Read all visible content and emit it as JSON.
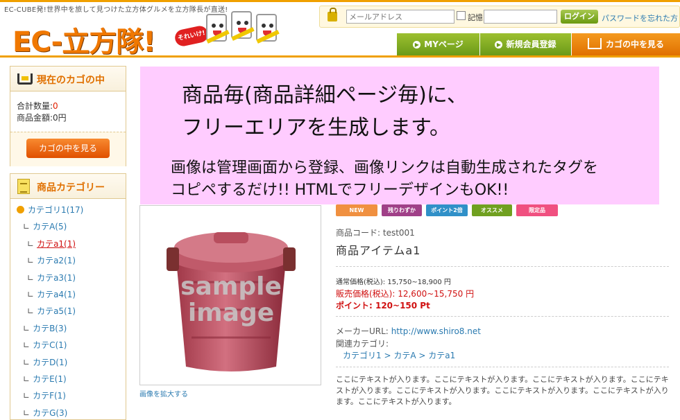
{
  "header": {
    "tagline": "EC-CUBE発!世界中を旅して見つけた立方体グルメを立方隊長が直送!",
    "logo_text": "EC-立方隊!",
    "logo_badge": "それいけ!"
  },
  "login": {
    "email_placeholder": "メールアドレス",
    "remember_label": "記憶",
    "login_button": "ログイン",
    "forgot_link": "パスワードを忘れた方"
  },
  "nav": {
    "mypage": "MYページ",
    "register": "新規会員登録",
    "cart": "カゴの中を見る"
  },
  "cart_box": {
    "title": "現在のカゴの中",
    "qty_label": "合計数量:",
    "qty_value": "0",
    "amount_label": "商品金額:",
    "amount_value": "0円",
    "view_button": "カゴの中を見る"
  },
  "category_box": {
    "title": "商品カテゴリー",
    "items": [
      {
        "label": "カテゴリ1(17)",
        "level": 1
      },
      {
        "label": "カテA(5)",
        "level": 2
      },
      {
        "label": "カテa1(1)",
        "level": 3,
        "active": true
      },
      {
        "label": "カテa2(1)",
        "level": 3
      },
      {
        "label": "カテa3(1)",
        "level": 3
      },
      {
        "label": "カテa4(1)",
        "level": 3
      },
      {
        "label": "カテa5(1)",
        "level": 3
      },
      {
        "label": "カテB(3)",
        "level": 2
      },
      {
        "label": "カテC(1)",
        "level": 2
      },
      {
        "label": "カテD(1)",
        "level": 2
      },
      {
        "label": "カテE(1)",
        "level": 2
      },
      {
        "label": "カテF(1)",
        "level": 2
      },
      {
        "label": "カテG(3)",
        "level": 2
      }
    ]
  },
  "overlay": {
    "line1": "商品毎(商品詳細ページ毎)に、",
    "line2": "フリーエリアを生成します。",
    "line3": "画像は管理画面から登録、画像リンクは自動生成されたタグを",
    "line4": "コピペするだけ!! HTMLでフリーデザインもOK!!"
  },
  "product": {
    "image_watermark_1": "sample",
    "image_watermark_2": "image",
    "zoom_link": "画像を拡大する",
    "badges": [
      {
        "label": "NEW",
        "color": "#f09040"
      },
      {
        "label": "残りわずか",
        "color": "#a04088"
      },
      {
        "label": "ポイント2倍",
        "color": "#3090c8"
      },
      {
        "label": "オススメ",
        "color": "#70a020"
      },
      {
        "label": "限定品",
        "color": "#f05080"
      }
    ],
    "code": "商品コード: test001",
    "name": "商品アイテムa1",
    "normal_price": "通常価格(税込): 15,750~18,900 円",
    "sale_price": "販売価格(税込): 12,600~15,750 円",
    "points": "ポイント: 120~150 Pt",
    "maker_label": "メーカーURL:",
    "maker_url": "http://www.shiro8.net",
    "related_label": "関連カテゴリ:",
    "related_path": "カテゴリ1 > カテA > カテa1",
    "free_text": "ここにテキストが入ります。ここにテキストが入ります。ここにテキストが入ります。ここにテキストが入ります。ここにテキストが入ります。ここにテキストが入ります。ここにテキストが入ります。ここにテキストが入ります。"
  }
}
